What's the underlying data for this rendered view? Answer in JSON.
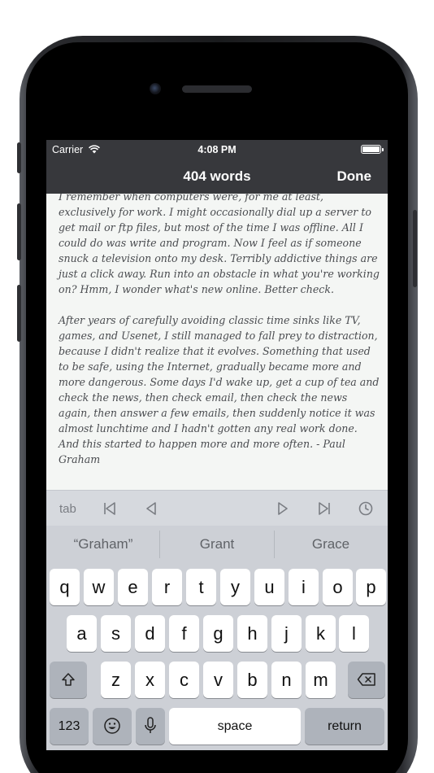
{
  "status": {
    "carrier": "Carrier",
    "time": "4:08 PM"
  },
  "navbar": {
    "title": "404 words",
    "done_label": "Done"
  },
  "editor": {
    "paragraphs": [
      "I remember when computers were, for me at least, exclusively for work. I might occasionally dial up a server to get mail or ftp files, but most of the time I was offline. All I could do was write and program. Now I feel as if someone snuck a television onto my desk. Terribly addictive things are just a click away. Run into an obstacle in what you're working on? Hmm, I wonder what's new online. Better check.",
      "After years of carefully avoiding classic time sinks like TV, games, and Usenet, I still managed to fall prey to distraction, because I didn't realize that it evolves. Something that used to be safe, using the Internet, gradually became more and more dangerous. Some days I'd wake up, get a cup of tea and check the news, then check email, then check the news again, then answer a few emails, then suddenly notice it was almost lunchtime and I hadn't gotten any real work done. And this started to happen more and more often. - Paul Graham"
    ]
  },
  "accessory": {
    "tab_label": "tab",
    "icons": [
      "skip-to-start-icon",
      "previous-icon",
      "next-icon",
      "skip-to-end-icon",
      "clock-icon"
    ]
  },
  "predictive": {
    "suggestions": [
      "“Graham”",
      "Grant",
      "Grace"
    ]
  },
  "keyboard": {
    "row1": [
      "q",
      "w",
      "e",
      "r",
      "t",
      "y",
      "u",
      "i",
      "o",
      "p"
    ],
    "row2": [
      "a",
      "s",
      "d",
      "f",
      "g",
      "h",
      "j",
      "k",
      "l"
    ],
    "row3": [
      "z",
      "x",
      "c",
      "v",
      "b",
      "n",
      "m"
    ],
    "numbers_label": "123",
    "space_label": "space",
    "return_label": "return"
  },
  "colors": {
    "bar_background": "#37383c",
    "editor_background": "#f4f6f4",
    "keyboard_background": "#cdd0d6"
  }
}
